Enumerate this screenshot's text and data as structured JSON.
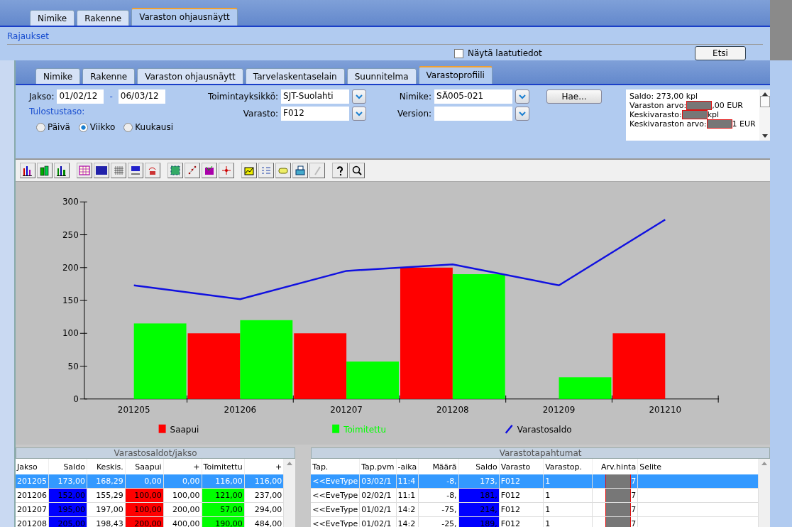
{
  "back_window": {
    "tabs": [
      {
        "label": "Nimike",
        "selected": false
      },
      {
        "label": "Rakenne",
        "selected": false
      },
      {
        "label": "Varaston ohjausnäytt",
        "selected": true
      }
    ],
    "group_title": "Rajaukset",
    "checkbox": {
      "label": "Näytä laatutiedot",
      "checked": false
    },
    "search_button": "Etsi"
  },
  "tabs": [
    {
      "label": "Nimike",
      "selected": false
    },
    {
      "label": "Rakenne",
      "selected": false
    },
    {
      "label": "Varaston ohjausnäytt",
      "selected": false
    },
    {
      "label": "Tarvelaskentaselain",
      "selected": false
    },
    {
      "label": "Suunnitelma",
      "selected": false
    },
    {
      "label": "Varastoprofiili",
      "selected": true
    }
  ],
  "form": {
    "period_label": "Jakso:",
    "period_start": "01/02/12",
    "period_separator": "-",
    "period_end": "06/03/12",
    "level_label": "Tulostustaso:",
    "levels": [
      {
        "label": "Päivä",
        "selected": false
      },
      {
        "label": "Viikko",
        "selected": true
      },
      {
        "label": "Kuukausi",
        "selected": false
      }
    ],
    "unit_label": "Toimintayksikkö:",
    "unit_value": "SJT-Suolahti",
    "warehouse_label": "Varasto:",
    "warehouse_value": "F012",
    "item_label": "Nimike:",
    "item_value": "SÄ005-021",
    "version_label": "Version:",
    "fetch_button": "Hae...",
    "summary": [
      {
        "prefix": "Saldo: 273,00 kpl",
        "redacted": false
      },
      {
        "prefix": "Varaston arvo: ",
        "redacted": true,
        "suffix": ",00 EUR"
      },
      {
        "prefix": "Keskivarasto:",
        "redacted": true,
        "suffix": "kpl"
      },
      {
        "prefix": "Keskivaraston arvo:",
        "redacted": true,
        "suffix": "1 EUR"
      }
    ]
  },
  "chart": {
    "chart_data": {
      "type": "bar",
      "categories": [
        "201205",
        "201206",
        "201207",
        "201208",
        "201209",
        "201210"
      ],
      "ylim": [
        0,
        300
      ],
      "legend": "bottom",
      "yticks": [
        0,
        50,
        100,
        150,
        200,
        250,
        300
      ],
      "series": [
        {
          "name": "Saapui",
          "color": "#ff0000",
          "type": "bar",
          "values": [
            null,
            100,
            100,
            200,
            null,
            100
          ]
        },
        {
          "name": "Toimitettu",
          "color": "#00ff00",
          "type": "bar",
          "values": [
            115,
            120,
            57,
            190,
            33,
            null
          ]
        },
        {
          "name": "Varastosaldo",
          "color": "#1010e0",
          "type": "line",
          "values": [
            173,
            152,
            195,
            205,
            173,
            273
          ]
        }
      ]
    }
  },
  "left_table": {
    "title": "Varastosaldot/jakso",
    "columns": [
      {
        "label": "Jakso",
        "kind": "text"
      },
      {
        "label": "Saldo",
        "kind": "number",
        "color": "#0000ff"
      },
      {
        "label": "Keskis.",
        "kind": "number"
      },
      {
        "label": "Saapui",
        "kind": "number",
        "color": "#ff0000"
      },
      {
        "label": "+",
        "kind": "number"
      },
      {
        "label": "Toimitettu",
        "kind": "number",
        "color": "#00ff00"
      },
      {
        "label": "+",
        "kind": "number"
      }
    ],
    "rows": [
      {
        "selected": true,
        "cells": [
          "201205",
          "173,00",
          "168,29",
          "0,00",
          "0,00",
          "116,00",
          "116,00"
        ]
      },
      {
        "selected": false,
        "cells": [
          "201206",
          "152,00",
          "155,29",
          "100,00",
          "100,00",
          "121,00",
          "237,00"
        ]
      },
      {
        "selected": false,
        "cells": [
          "201207",
          "195,00",
          "197,00",
          "100,00",
          "200,00",
          "57,00",
          "294,00"
        ]
      },
      {
        "selected": false,
        "cells": [
          "201208",
          "205,00",
          "198,43",
          "200,00",
          "400,00",
          "190,00",
          "484,00"
        ]
      }
    ]
  },
  "right_table": {
    "title": "Varastotapahtumat",
    "columns": [
      {
        "label": "Tap.",
        "kind": "text"
      },
      {
        "label": "Tap.pvm",
        "kind": "text"
      },
      {
        "label": "-aika",
        "kind": "text"
      },
      {
        "label": "Määrä",
        "kind": "number"
      },
      {
        "label": "Saldo",
        "kind": "number",
        "color": "#0000ff"
      },
      {
        "label": "Varasto",
        "kind": "text"
      },
      {
        "label": "Varastop.",
        "kind": "text"
      },
      {
        "label": "Arv.hinta",
        "kind": "redacted"
      },
      {
        "label": "Selite",
        "kind": "text"
      }
    ],
    "rows": [
      {
        "selected": true,
        "cells": [
          "<<EveType",
          "03/02/1",
          "11:4",
          "-8,",
          "173,",
          "F012",
          "1",
          "7",
          ""
        ]
      },
      {
        "selected": false,
        "cells": [
          "<<EveType",
          "02/02/1",
          "11:1",
          "-8,",
          "181,",
          "F012",
          "1",
          "7",
          ""
        ]
      },
      {
        "selected": false,
        "cells": [
          "<<EveType",
          "01/02/1",
          "14:2",
          "-75,",
          "214,",
          "F012",
          "1",
          "7",
          ""
        ]
      },
      {
        "selected": false,
        "cells": [
          "<<EveType",
          "01/02/1",
          "14:2",
          "-25,",
          "189,",
          "F012",
          "1",
          "7",
          ""
        ]
      }
    ]
  }
}
